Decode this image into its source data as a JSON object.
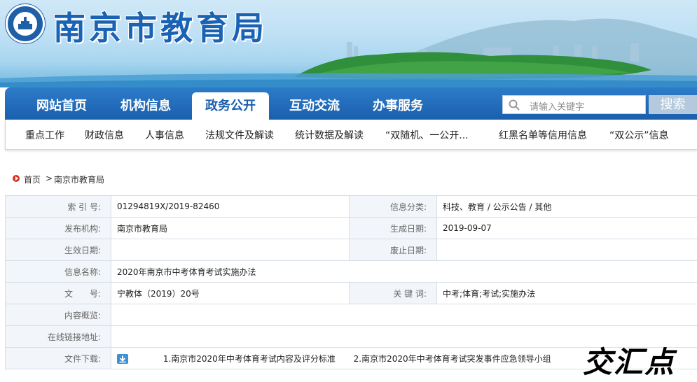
{
  "site": {
    "title": "南京市教育局",
    "logo_icon": "nanjing-education-bureau-seal-icon"
  },
  "main_nav": {
    "items": [
      {
        "label": "网站首页"
      },
      {
        "label": "机构信息"
      },
      {
        "label": "政务公开"
      },
      {
        "label": "互动交流"
      },
      {
        "label": "办事服务"
      }
    ],
    "active_index": 2
  },
  "search": {
    "placeholder": "请输入关键字",
    "button_label": "搜索"
  },
  "sub_nav": {
    "items": [
      {
        "label": "重点工作"
      },
      {
        "label": "财政信息"
      },
      {
        "label": "人事信息"
      },
      {
        "label": "法规文件及解读"
      },
      {
        "label": "统计数据及解读"
      },
      {
        "label": "“双随机、一公开..."
      },
      {
        "label": "红黑名单等信用信息"
      },
      {
        "label": "“双公示”信息"
      }
    ]
  },
  "breadcrumb": {
    "items": [
      "首页",
      "南京市教育局"
    ],
    "separator": ">"
  },
  "info_table": {
    "index_no": {
      "label": "索 引 号:",
      "value": "01294819X/2019-82460"
    },
    "category": {
      "label": "信息分类:",
      "value": "科技、教育 / 公示公告 / 其他"
    },
    "publisher": {
      "label": "发布机构:",
      "value": "南京市教育局"
    },
    "created_date": {
      "label": "生成日期:",
      "value": "2019-09-07"
    },
    "effective_date": {
      "label": "生效日期:",
      "value": ""
    },
    "expiry_date": {
      "label": "废止日期:",
      "value": ""
    },
    "info_name": {
      "label": "信息名称:",
      "value": "2020年南京市中考体育考试实施办法"
    },
    "doc_no": {
      "label": "文　　号:",
      "value": "宁教体（2019）20号"
    },
    "keywords": {
      "label": "关 键 词:",
      "value": "中考;体育;考试;实施办法"
    },
    "summary": {
      "label": "内容概览:",
      "value": ""
    },
    "online_link": {
      "label": "在线链接地址:",
      "value": ""
    },
    "downloads": {
      "label": "文件下载:",
      "files": [
        "1.南京市2020年中考体育考试内容及评分标准",
        "2.南京市2020年中考体育考试突发事件应急领导小组"
      ]
    }
  },
  "watermark": {
    "text": "交汇点"
  },
  "colors": {
    "brand_blue": "#1a5fae",
    "title_blue": "#1a62b3",
    "label_bg": "#f2f5f9",
    "border": "#d6dee8",
    "home_red": "#d9342b"
  }
}
